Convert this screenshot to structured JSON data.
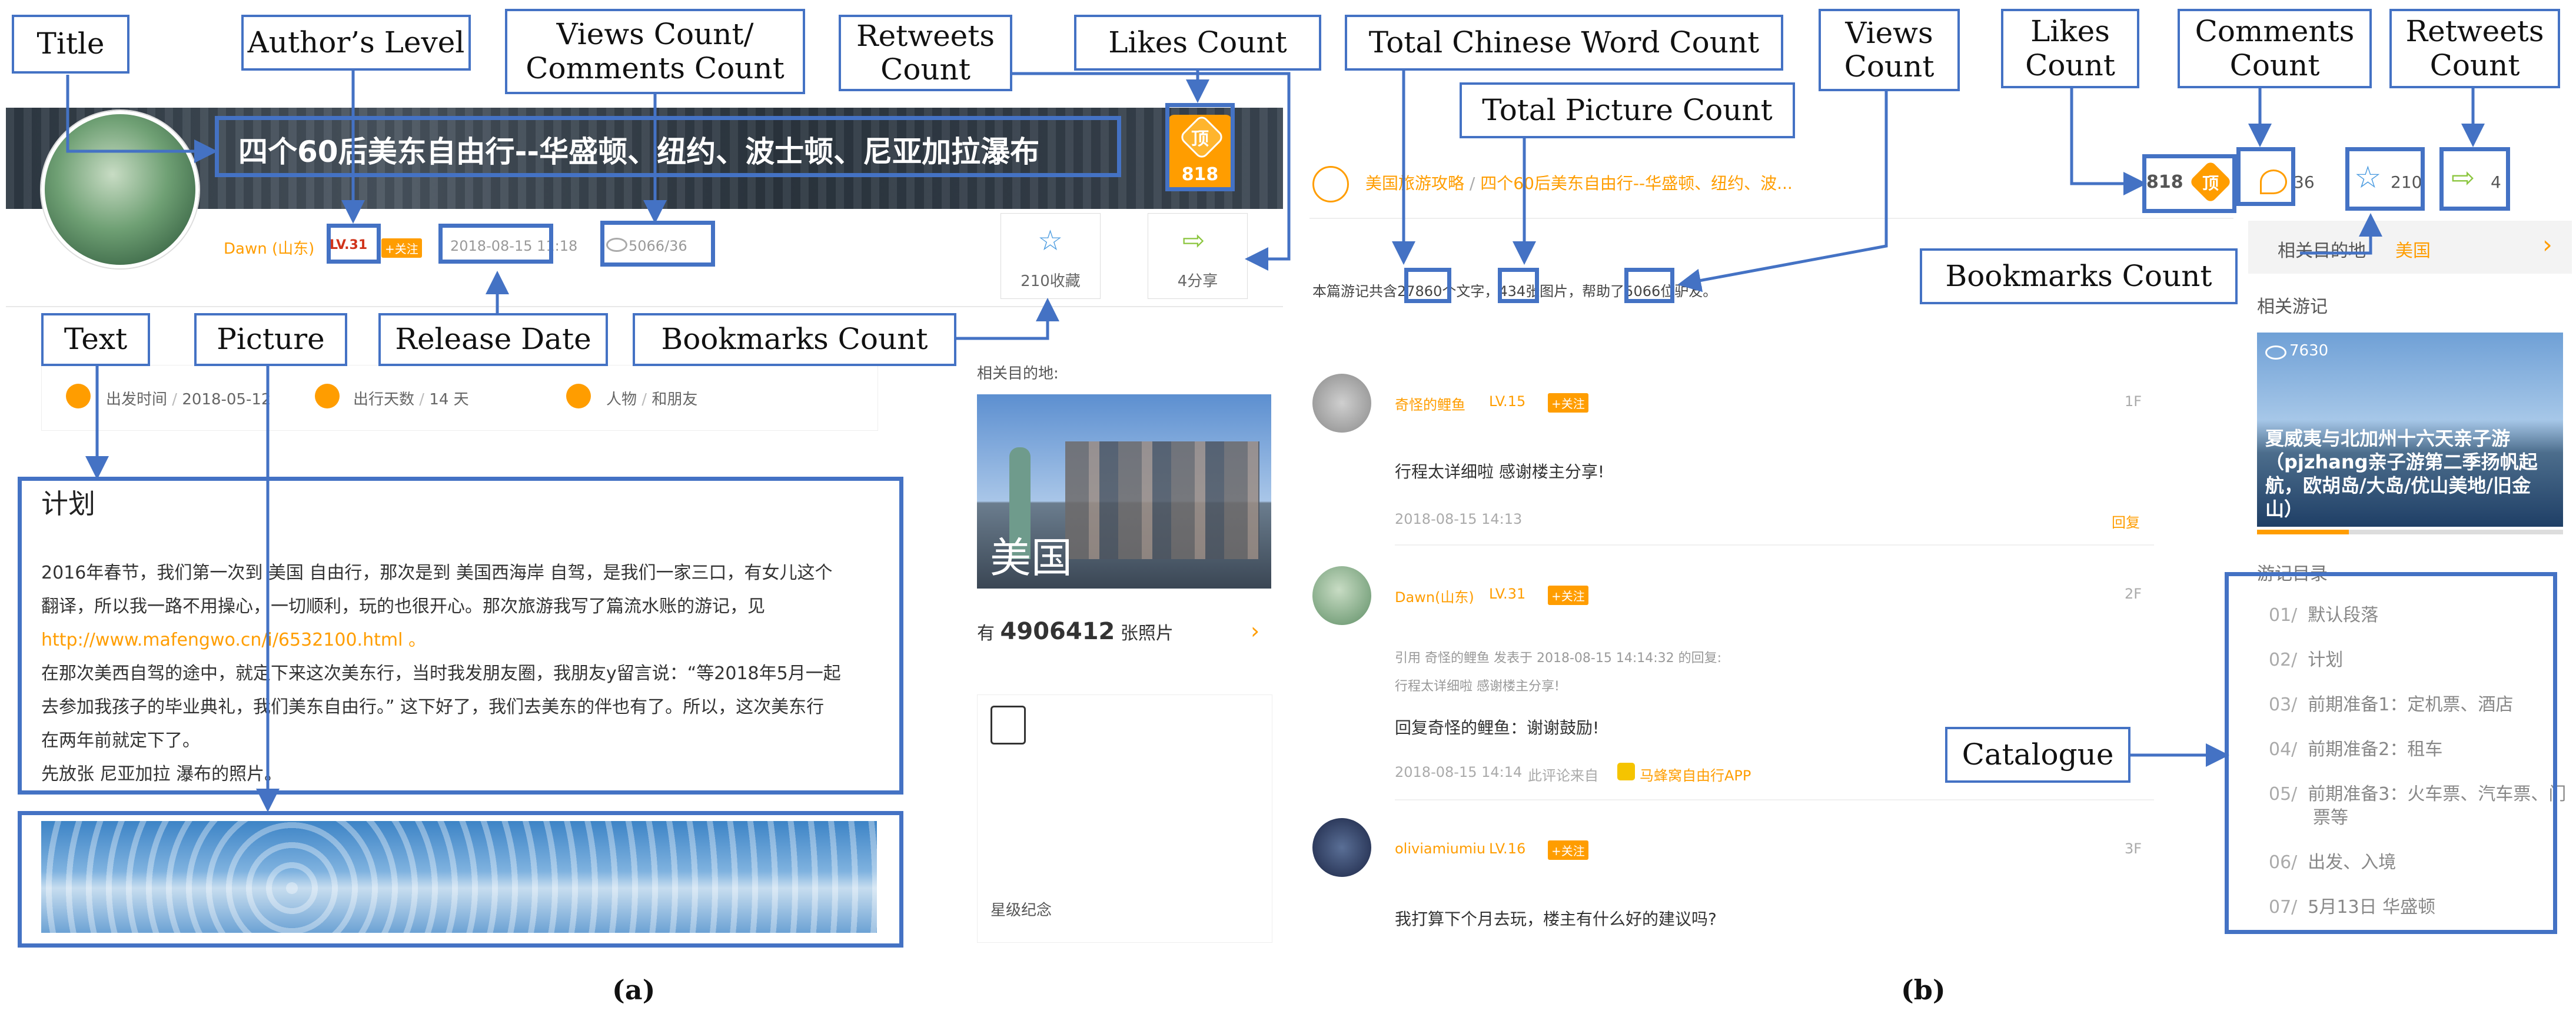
{
  "panel_a": {
    "title": "四个60后美东自由行--华盛顿、纽约、波士顿、尼亚加拉瀑布",
    "likes": {
      "icon_text": "顶",
      "count": "818"
    },
    "author": {
      "name": "Dawn (山东)",
      "level": "LV.31",
      "follow": "+关注"
    },
    "release_date": "2018-08-15 11:18",
    "views_comments": "5066/36",
    "bookmark_label": "210收藏",
    "share_label": "4分享",
    "trip_info": [
      {
        "label": "出发时间",
        "value": "2018-05-12"
      },
      {
        "label": "出行天数",
        "value": "14 天"
      },
      {
        "label": "人物",
        "value": "和朋友"
      }
    ],
    "section_heading": "计划",
    "body_lines": [
      "2016年春节，我们第一次到 美国 自由行，那次是到 美国西海岸 自驾，是我们一家三口，有女儿这个",
      "翻译，所以我一路不用操心，一切顺利，玩的也很开心。那次旅游我写了篇流水账的游记，见",
      "http://www.mafengwo.cn/i/6532100.html 。",
      "在那次美西自驾的途中，就定下来这次美东行，当时我发朋友圈，我朋友y留言说：“等2018年5月一起",
      "去参加我孩子的毕业典礼，我们美东自由行。” 这下好了，我们去美东的伴也有了。所以，这次美东行",
      "在两年前就定下了。",
      "先放张 尼亚加拉 瀑布的照片。"
    ],
    "sidebar": {
      "dest_heading": "相关目的地:",
      "dest_name": "美国",
      "photo_prefix": "有",
      "photo_count": "4906412",
      "photo_suffix": "张照片",
      "card_caption": "星级纪念"
    }
  },
  "panel_b": {
    "breadcrumb_a": "美国旅游攻略",
    "breadcrumb_sep": "/",
    "breadcrumb_b": "四个60后美东自由行--华盛顿、纽约、波...",
    "likes_count": "818",
    "likes_icon": "顶",
    "comments_count": "36",
    "bookmarks_count": "210",
    "retweets_count": "4",
    "stats_line": {
      "p1": "本篇游记共含",
      "words": "27860",
      "p2": "个文字，",
      "pics": "434",
      "p3": "张图片，帮助了",
      "views": "5066",
      "p4": "位驴友。"
    },
    "comments": [
      {
        "user": "奇怪的鲤鱼",
        "level": "LV.15",
        "follow": "+关注",
        "floor": "1F",
        "text": "行程太详细啦 感谢楼主分享!",
        "time": "2018-08-15 14:13",
        "reply": "回复"
      },
      {
        "user": "Dawn(山东)",
        "level": "LV.31",
        "follow": "+关注",
        "floor": "2F",
        "quote1": "引用 奇怪的鲤鱼 发表于 2018-08-15 14:14:32 的回复:",
        "quote2": "行程太详细啦 感谢楼主分享!",
        "text": "回复奇怪的鲤鱼：谢谢鼓励!",
        "time": "2018-08-15 14:14",
        "source_prefix": "此评论来自",
        "source_app": "马蜂窝自由行APP"
      },
      {
        "user": "oliviamiumiu",
        "level": "LV.16",
        "follow": "+关注",
        "floor": "3F",
        "text": "我打算下个月去玩，楼主有什么好的建议吗?"
      }
    ],
    "sidebar": {
      "dest_label": "相关目的地",
      "dest_value": "美国",
      "related_heading": "相关游记",
      "related_views": "7630",
      "related_title": "夏威夷与北加州十六天亲子游（pjzhang亲子游第二季扬帆起航，欧胡岛/大岛/优山美地/旧金山）",
      "catalogue_heading": "游记目录",
      "catalogue": [
        {
          "num": "01/",
          "label": "默认段落"
        },
        {
          "num": "02/",
          "label": "计划"
        },
        {
          "num": "03/",
          "label": "前期准备1：定机票、酒店"
        },
        {
          "num": "04/",
          "label": "前期准备2：租车"
        },
        {
          "num": "05/",
          "label": "前期准备3：火车票、汽车票、门"
        },
        {
          "num": "",
          "label": "票等"
        },
        {
          "num": "06/",
          "label": "出发、入境"
        },
        {
          "num": "07/",
          "label": "5月13日 华盛顿"
        }
      ]
    }
  },
  "annotations": {
    "title": "Title",
    "author_level": "Author’s Level",
    "views_comments_1": "Views Count/",
    "views_comments_2": "Comments Count",
    "retweets_a_1": "Retweets",
    "retweets_a_2": "Count",
    "likes_a": "Likes Count",
    "text": "Text",
    "picture": "Picture",
    "release_date": "Release Date",
    "bookmarks_a": "Bookmarks Count",
    "chinese_words": "Total Chinese Word Count",
    "total_pictures": "Total Picture Count",
    "views_b_1": "Views",
    "views_b_2": "Count",
    "likes_b_1": "Likes",
    "likes_b_2": "Count",
    "comments_b_1": "Comments",
    "comments_b_2": "Count",
    "retweets_b_1": "Retweets",
    "retweets_b_2": "Count",
    "bookmarks_b": "Bookmarks Count",
    "catalogue": "Catalogue"
  },
  "captions": {
    "a": "(a)",
    "b": "(b)"
  },
  "colors": {
    "accent_orange": "#ff9d00",
    "annotation_blue": "#4472c4"
  }
}
